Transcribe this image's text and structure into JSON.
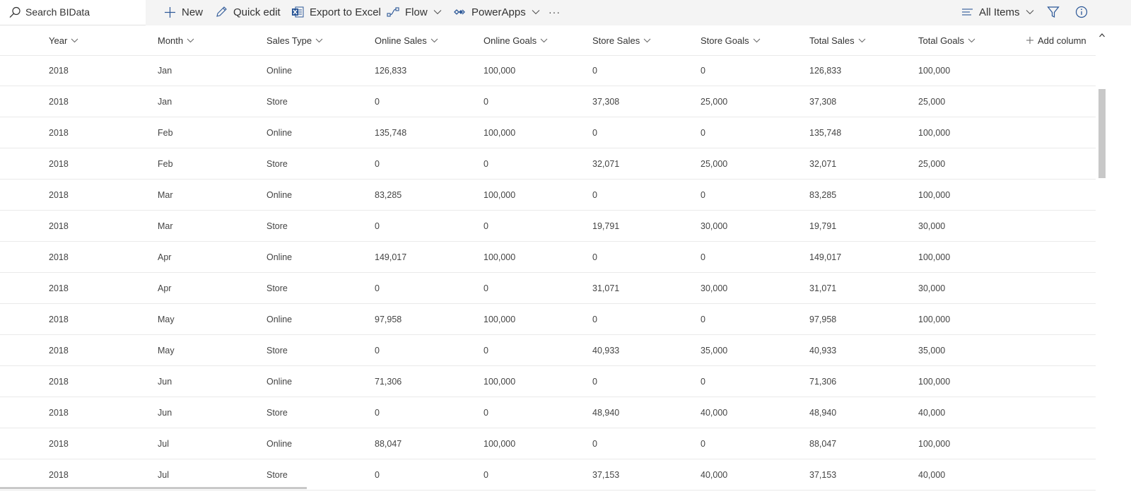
{
  "search": {
    "placeholder": "Search BIData"
  },
  "toolbar": {
    "new_label": "New",
    "quick_edit_label": "Quick edit",
    "export_label": "Export to Excel",
    "flow_label": "Flow",
    "powerapps_label": "PowerApps",
    "more_label": "···",
    "view_label": "All Items"
  },
  "colors": {
    "excel": "#2b5797",
    "powerapps": "#2b5797",
    "text": "#333333"
  },
  "icons": {
    "search": "search-icon",
    "new": "plus-icon",
    "edit": "pencil-icon",
    "excel": "excel-icon",
    "flow": "flow-icon",
    "powerapps": "powerapps-icon",
    "view": "list-lines-icon",
    "filter": "filter-icon",
    "info": "info-icon"
  },
  "columns": [
    "Year",
    "Month",
    "Sales Type",
    "Online Sales",
    "Online Goals",
    "Store Sales",
    "Store Goals",
    "Total Sales",
    "Total Goals"
  ],
  "add_column_label": "Add column",
  "rows": [
    [
      "2018",
      "Jan",
      "Online",
      "126,833",
      "100,000",
      "0",
      "0",
      "126,833",
      "100,000"
    ],
    [
      "2018",
      "Jan",
      "Store",
      "0",
      "0",
      "37,308",
      "25,000",
      "37,308",
      "25,000"
    ],
    [
      "2018",
      "Feb",
      "Online",
      "135,748",
      "100,000",
      "0",
      "0",
      "135,748",
      "100,000"
    ],
    [
      "2018",
      "Feb",
      "Store",
      "0",
      "0",
      "32,071",
      "25,000",
      "32,071",
      "25,000"
    ],
    [
      "2018",
      "Mar",
      "Online",
      "83,285",
      "100,000",
      "0",
      "0",
      "83,285",
      "100,000"
    ],
    [
      "2018",
      "Mar",
      "Store",
      "0",
      "0",
      "19,791",
      "30,000",
      "19,791",
      "30,000"
    ],
    [
      "2018",
      "Apr",
      "Online",
      "149,017",
      "100,000",
      "0",
      "0",
      "149,017",
      "100,000"
    ],
    [
      "2018",
      "Apr",
      "Store",
      "0",
      "0",
      "31,071",
      "30,000",
      "31,071",
      "30,000"
    ],
    [
      "2018",
      "May",
      "Online",
      "97,958",
      "100,000",
      "0",
      "0",
      "97,958",
      "100,000"
    ],
    [
      "2018",
      "May",
      "Store",
      "0",
      "0",
      "40,933",
      "35,000",
      "40,933",
      "35,000"
    ],
    [
      "2018",
      "Jun",
      "Online",
      "71,306",
      "100,000",
      "0",
      "0",
      "71,306",
      "100,000"
    ],
    [
      "2018",
      "Jun",
      "Store",
      "0",
      "0",
      "48,940",
      "40,000",
      "48,940",
      "40,000"
    ],
    [
      "2018",
      "Jul",
      "Online",
      "88,047",
      "100,000",
      "0",
      "0",
      "88,047",
      "100,000"
    ],
    [
      "2018",
      "Jul",
      "Store",
      "0",
      "0",
      "37,153",
      "40,000",
      "37,153",
      "40,000"
    ]
  ]
}
